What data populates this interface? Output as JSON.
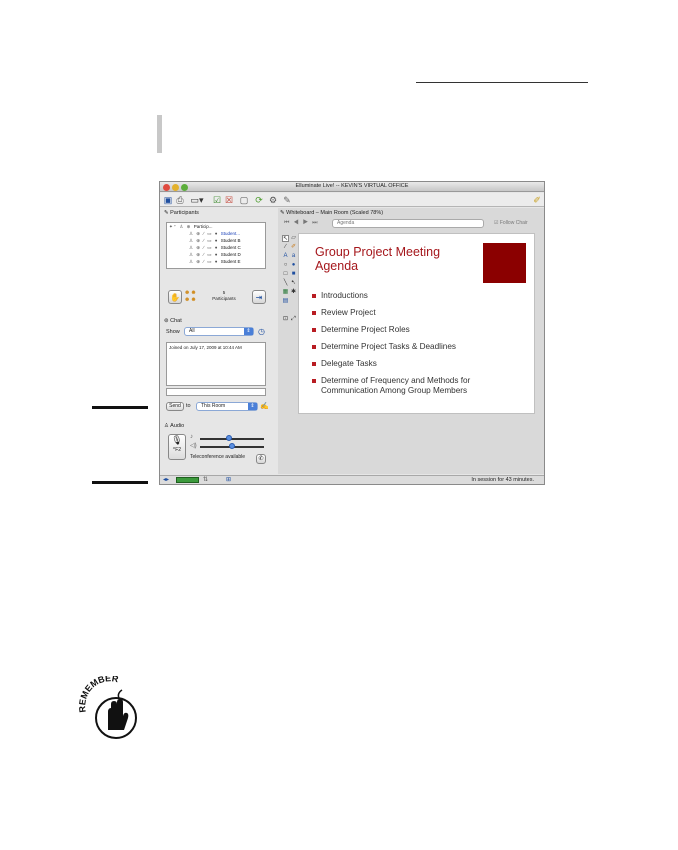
{
  "window": {
    "title": "Elluminate Live! -- KEVIN'S VIRTUAL OFFICE"
  },
  "participants": {
    "heading": "Participants",
    "column_header": "Particip...",
    "rows": [
      "Student...",
      "Student B",
      "Student C",
      "Student D",
      "Student E"
    ],
    "count": "5",
    "count_label": "Participants"
  },
  "chat": {
    "heading": "Chat",
    "show_label": "Show",
    "show_value": "All",
    "log": [
      "Joined on July 17, 2009 at 10:44 AM"
    ],
    "send_label": "Send",
    "to_label": "to",
    "recipient_value": "This Room"
  },
  "audio": {
    "heading": "Audio",
    "talk_key": "^F2",
    "teleconference": "Teleconference available",
    "speaker_level": 0.45,
    "mic_level": 0.5
  },
  "whiteboard": {
    "heading": "Whiteboard – Main Room (Scaled 78%)",
    "page_select": "Agenda",
    "follow_chair": "Follow Chair",
    "slide": {
      "title_line1": "Group Project Meeting",
      "title_line2": "Agenda",
      "bullets": [
        [
          "Introductions"
        ],
        [
          "Review Project"
        ],
        [
          "Determine Project Roles"
        ],
        [
          "Determine Project Tasks & Deadlines"
        ],
        [
          "Delegate Tasks"
        ],
        [
          "Determine of Frequency and Methods for",
          "Communication Among Group Members"
        ]
      ],
      "accent_color": "#8b0000"
    }
  },
  "status": {
    "session": "In session for 43 minutes."
  },
  "icons": [
    "save-icon",
    "print-icon",
    "layout-icon",
    "poll-icon",
    "close-poll-icon",
    "screen-icon",
    "refresh-icon",
    "tools-icon",
    "notes-icon",
    "help-icon"
  ],
  "remember_badge": "REMEMBER"
}
